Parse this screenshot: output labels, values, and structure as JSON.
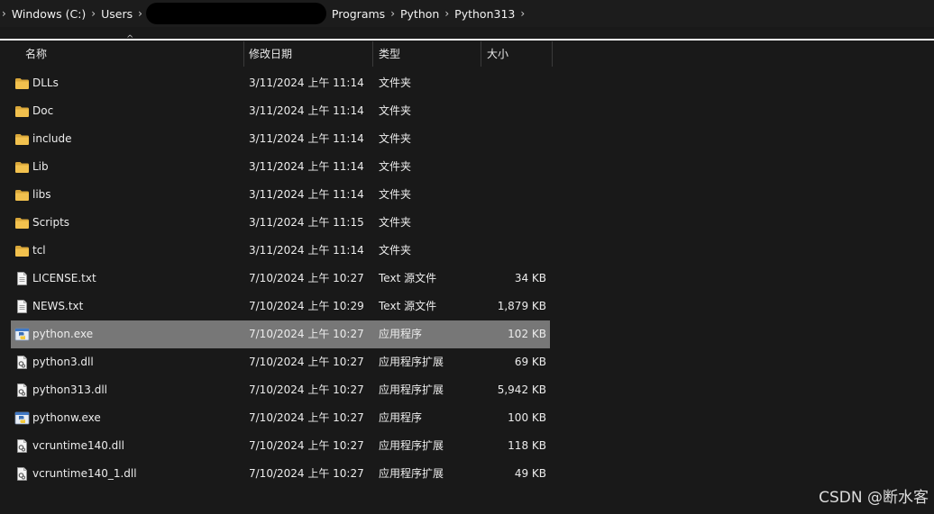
{
  "breadcrumb": {
    "segments": [
      "Windows (C:)",
      "Users",
      "Programs",
      "Python",
      "Python313"
    ]
  },
  "columns": {
    "name": "名称",
    "date": "修改日期",
    "type": "类型",
    "size": "大小"
  },
  "rows": [
    {
      "name": "DLLs",
      "date": "3/11/2024 上午 11:14",
      "type": "文件夹",
      "size": "",
      "icon": "folder-icon"
    },
    {
      "name": "Doc",
      "date": "3/11/2024 上午 11:14",
      "type": "文件夹",
      "size": "",
      "icon": "folder-icon"
    },
    {
      "name": "include",
      "date": "3/11/2024 上午 11:14",
      "type": "文件夹",
      "size": "",
      "icon": "folder-icon"
    },
    {
      "name": "Lib",
      "date": "3/11/2024 上午 11:14",
      "type": "文件夹",
      "size": "",
      "icon": "folder-icon"
    },
    {
      "name": "libs",
      "date": "3/11/2024 上午 11:14",
      "type": "文件夹",
      "size": "",
      "icon": "folder-icon"
    },
    {
      "name": "Scripts",
      "date": "3/11/2024 上午 11:15",
      "type": "文件夹",
      "size": "",
      "icon": "folder-icon"
    },
    {
      "name": "tcl",
      "date": "3/11/2024 上午 11:14",
      "type": "文件夹",
      "size": "",
      "icon": "folder-icon"
    },
    {
      "name": "LICENSE.txt",
      "date": "7/10/2024 上午 10:27",
      "type": "Text 源文件",
      "size": "34 KB",
      "icon": "text-file-icon"
    },
    {
      "name": "NEWS.txt",
      "date": "7/10/2024 上午 10:29",
      "type": "Text 源文件",
      "size": "1,879 KB",
      "icon": "text-file-icon"
    },
    {
      "name": "python.exe",
      "date": "7/10/2024 上午 10:27",
      "type": "应用程序",
      "size": "102 KB",
      "icon": "python-exe-icon",
      "selected": true
    },
    {
      "name": "python3.dll",
      "date": "7/10/2024 上午 10:27",
      "type": "应用程序扩展",
      "size": "69 KB",
      "icon": "dll-file-icon"
    },
    {
      "name": "python313.dll",
      "date": "7/10/2024 上午 10:27",
      "type": "应用程序扩展",
      "size": "5,942 KB",
      "icon": "dll-file-icon"
    },
    {
      "name": "pythonw.exe",
      "date": "7/10/2024 上午 10:27",
      "type": "应用程序",
      "size": "100 KB",
      "icon": "python-exe-icon"
    },
    {
      "name": "vcruntime140.dll",
      "date": "7/10/2024 上午 10:27",
      "type": "应用程序扩展",
      "size": "118 KB",
      "icon": "dll-file-icon"
    },
    {
      "name": "vcruntime140_1.dll",
      "date": "7/10/2024 上午 10:27",
      "type": "应用程序扩展",
      "size": "49 KB",
      "icon": "dll-file-icon"
    }
  ],
  "colors": {
    "background": "#191919",
    "selected_row": "#777777",
    "folder": "#f2c14e"
  },
  "watermark": "CSDN @断水客"
}
